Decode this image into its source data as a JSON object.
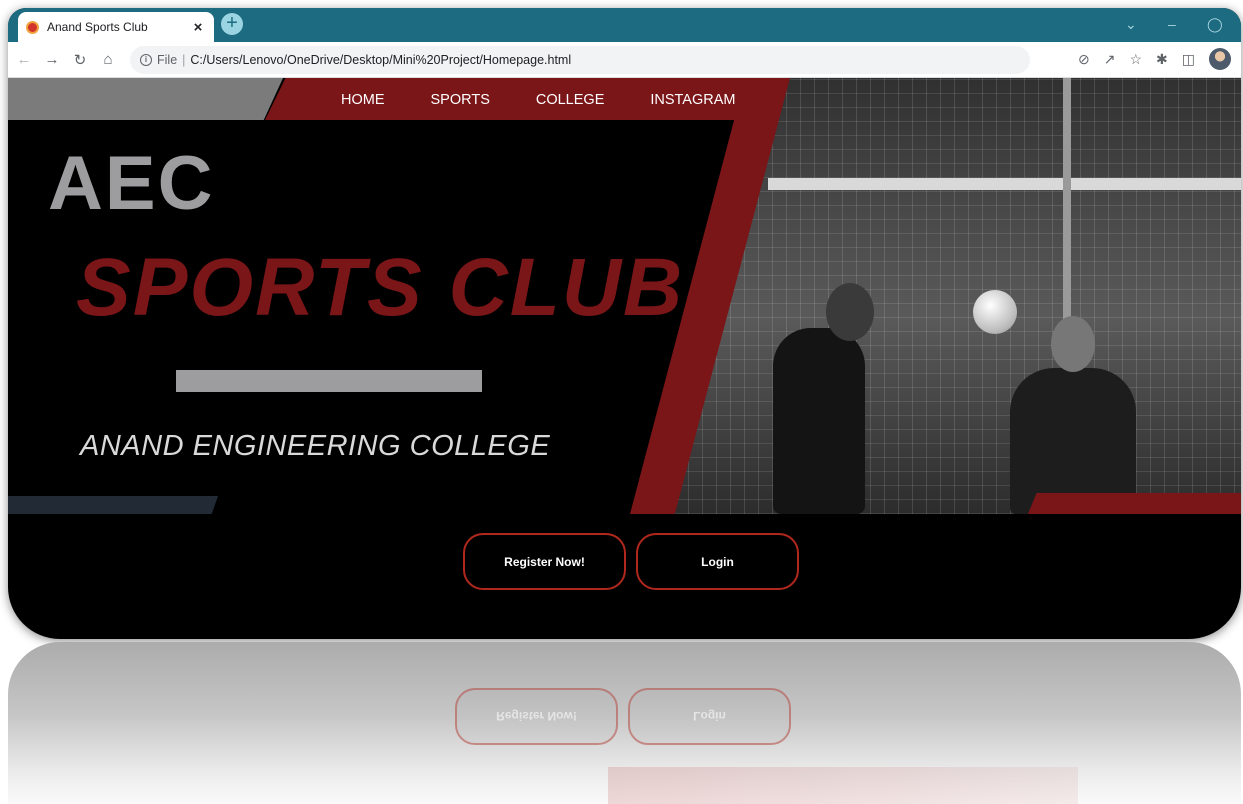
{
  "browser": {
    "tab_title": "Anand Sports Club",
    "tab_close": "×",
    "new_tab": "+",
    "url_scheme": "File",
    "url_separator": "|",
    "url_path": "C:/Users/Lenovo/OneDrive/Desktop/Mini%20Project/Homepage.html",
    "window_controls": [
      "chevron-down-icon",
      "minimize-icon",
      "restore-icon"
    ],
    "toolbar_icons": [
      "eye-off-icon",
      "share-icon",
      "star-icon",
      "extensions-icon",
      "sidepanel-icon",
      "profile-avatar"
    ]
  },
  "nav": {
    "items": [
      "HOME",
      "SPORTS",
      "COLLEGE",
      "INSTAGRAM"
    ]
  },
  "hero": {
    "title_line1": "AEC",
    "title_line2": "SPORTS CLUB",
    "subtitle": "ANAND ENGINEERING COLLEGE"
  },
  "actions": {
    "register_label": "Register Now!",
    "login_label": "Login"
  },
  "colors": {
    "brand_red": "#7a1518",
    "brand_gray": "#9d9d9f",
    "tab_strip": "#1c6b80",
    "button_border": "#b0281d"
  }
}
